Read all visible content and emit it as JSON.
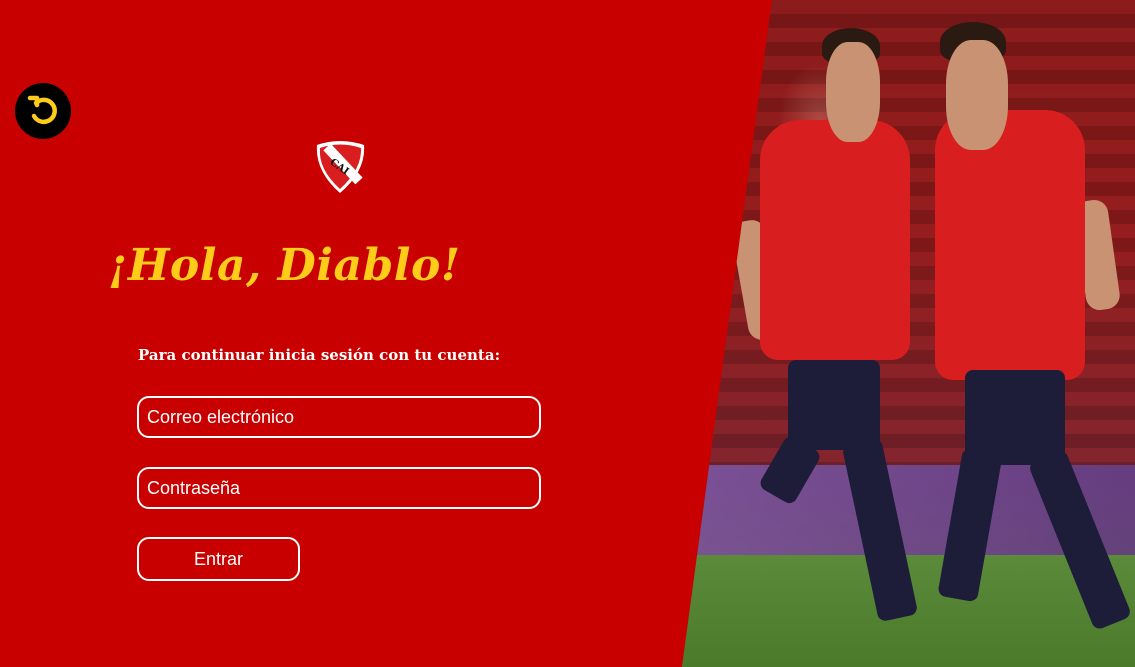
{
  "login": {
    "title": "¡Hola, Diablo!",
    "subtitle": "Para continuar inicia sesión con tu cuenta:",
    "email_placeholder": "Correo electrónico",
    "email_value": "",
    "password_placeholder": "Contraseña",
    "password_value": "",
    "submit_label": "Entrar"
  },
  "logo": {
    "text": "CAI"
  },
  "icons": {
    "back": "undo-arrow-icon",
    "logo": "club-crest-icon"
  },
  "colors": {
    "background": "#c80000",
    "title": "#ffcc1a",
    "text": "#ffffff",
    "back_button_bg": "#000000",
    "back_button_icon": "#ffcc1a"
  }
}
